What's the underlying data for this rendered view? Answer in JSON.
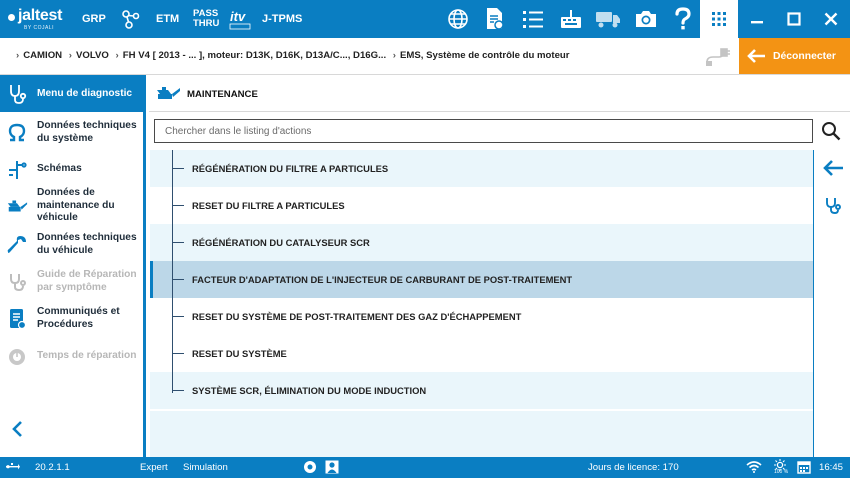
{
  "topbar": {
    "logo_text": "jaltest",
    "logo_sub": "BY COJALI",
    "grp": "GRP",
    "etm": "ETM",
    "pass_line1": "PASS",
    "pass_line2": "THRU",
    "jtpms": "J-TPMS",
    "icons": [
      "globe-icon",
      "document-settings-icon",
      "list-icon",
      "keyboard-icon",
      "truck-icon",
      "camera-icon",
      "help-icon",
      "grid-icon"
    ],
    "window_controls": [
      "minimize",
      "maximize",
      "close"
    ]
  },
  "breadcrumb": {
    "items": [
      "CAMION",
      "VOLVO",
      "FH V4 [ 2013 - ... ], moteur: D13K, D16K, D13A/C..., D16G...",
      "EMS, Système de contrôle du moteur"
    ],
    "disconnect_label": "Déconnecter"
  },
  "sidebar": {
    "header": "Menu de diagnostic",
    "items": [
      {
        "label": "Données techniques du système",
        "icon": "omega-icon",
        "enabled": true
      },
      {
        "label": "Schémas",
        "icon": "schematic-icon",
        "enabled": true
      },
      {
        "label": "Données de maintenance du véhicule",
        "icon": "oil-can-icon",
        "enabled": true
      },
      {
        "label": "Données techniques du véhicule",
        "icon": "wrench-icon",
        "enabled": true
      },
      {
        "label": "Guide de Réparation par symptôme",
        "icon": "stethoscope-icon",
        "enabled": false
      },
      {
        "label": "Communiqués et Procédures",
        "icon": "bulletin-icon",
        "enabled": true
      },
      {
        "label": "Temps de réparation",
        "icon": "repair-time-icon",
        "enabled": false
      }
    ]
  },
  "main": {
    "title": "MAINTENANCE",
    "search_placeholder": "Chercher dans le listing d'actions",
    "actions": [
      "RÉGÉNÉRATION DU FILTRE A PARTICULES",
      "RESET DU FILTRE A PARTICULES",
      "RÉGÉNÉRATION DU CATALYSEUR SCR",
      "FACTEUR D'ADAPTATION DE L'INJECTEUR DE CARBURANT DE POST-TRAITEMENT",
      "RESET DU SYSTÈME DE POST-TRAITEMENT DES GAZ D'ÉCHAPPEMENT",
      "RESET DU SYSTÈME",
      "SYSTÈME SCR, ÉLIMINATION DU MODE INDUCTION"
    ],
    "selected_index": 3
  },
  "statusbar": {
    "version": "20.2.1.1",
    "mode": "Expert",
    "simulation": "Simulation",
    "license": "Jours de licence: 170",
    "battery": "100 %",
    "time": "16:45"
  },
  "colors": {
    "primary": "#0a7ec2",
    "accent": "#f39314",
    "row_alt": "#eaf6fb",
    "row_selected": "#bcd7e8"
  }
}
